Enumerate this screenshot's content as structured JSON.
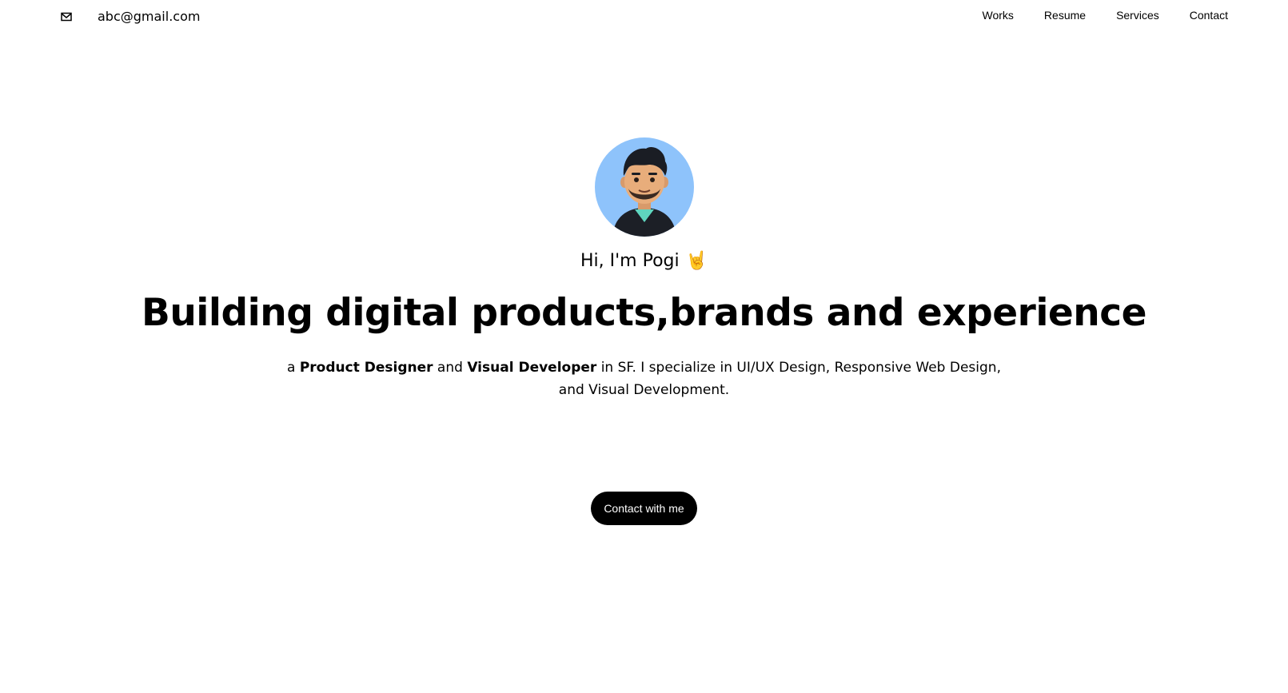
{
  "header": {
    "email": "abc@gmail.com",
    "mail_icon": "mail-icon",
    "nav": [
      {
        "label": "Works"
      },
      {
        "label": "Resume"
      },
      {
        "label": "Services"
      },
      {
        "label": "Contact"
      }
    ]
  },
  "hero": {
    "avatar": "avatar-illustration",
    "greeting": "Hi, I'm Pogi",
    "greeting_emoji": "🤘",
    "headline": "Building digital products,brands and experience",
    "intro": {
      "prefix": "a ",
      "role1": "Product Designer",
      "and": " and ",
      "role2": "Visual Developer",
      "suffix": " in SF. I specialize in UI/UX Design, Responsive Web Design, and Visual Development."
    },
    "cta_label": "Contact with me"
  },
  "colors": {
    "avatar_bg": "#8ec3fb",
    "cta_bg": "#000000",
    "cta_text": "#ffffff"
  }
}
